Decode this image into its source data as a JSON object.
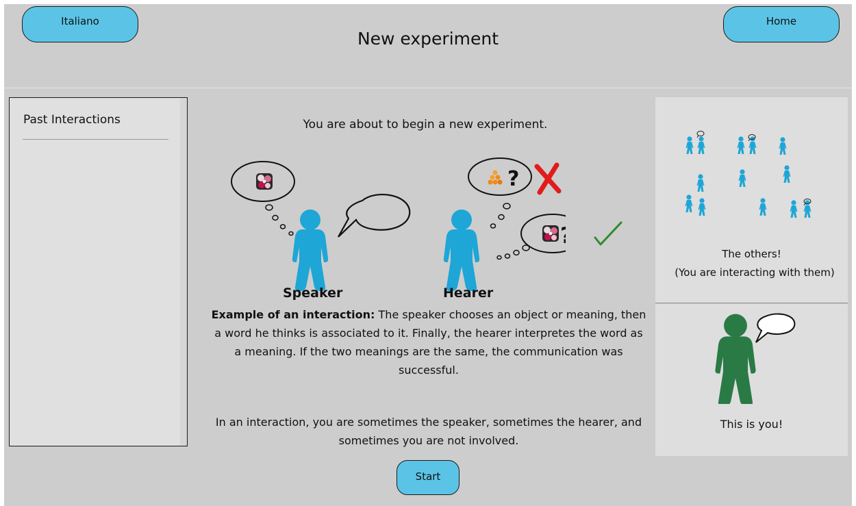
{
  "header": {
    "language_button": "Italiano",
    "home_button": "Home",
    "title": "New experiment"
  },
  "sidebar": {
    "title": "Past Interactions"
  },
  "main": {
    "intro": "You are about to begin a new experiment.",
    "speaker_label": "Speaker",
    "hearer_label": "Hearer",
    "example_bold": "Example of an interaction:",
    "example_text": " The speaker chooses an object or meaning, then a word he thinks is associated to it. Finally, the hearer interpretes the word as a meaning. If the two meanings are the same, the communication was successful.",
    "note": "In an interaction, you are sometimes the speaker, sometimes the hearer, and sometimes you are not involved.",
    "start_button": "Start"
  },
  "right": {
    "others_line1": "The others!",
    "others_line2": "(You are interacting with them)",
    "you_text": "This is you!"
  },
  "colors": {
    "accent": "#5bc4e6",
    "figure_blue": "#1ea6d6",
    "figure_green": "#2a7a45",
    "wrong": "#e21b1b",
    "right": "#2e8b2e"
  }
}
